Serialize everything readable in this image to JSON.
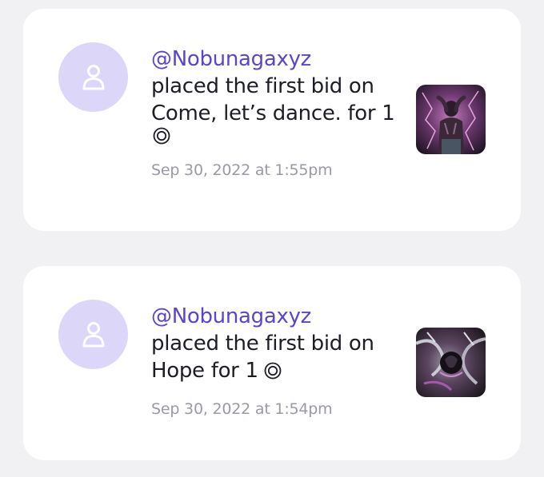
{
  "notifications": [
    {
      "handle": "@Nobunagaxyz",
      "message": "placed the first bid on Come, let’s dance. for 1",
      "currency_icon": "currency-icon",
      "timestamp": "Sep 30, 2022 at 1:55pm",
      "avatar_icon": "user-icon",
      "thumbnail": "nft-thumbnail"
    },
    {
      "handle": "@Nobunagaxyz",
      "message": "placed the first bid on Hope for 1",
      "currency_icon": "currency-icon",
      "timestamp": "Sep 30, 2022 at 1:54pm",
      "avatar_icon": "user-icon",
      "thumbnail": "nft-thumbnail"
    }
  ],
  "colors": {
    "background": "#f1f1f3",
    "card": "#ffffff",
    "handle": "#5a45cf",
    "avatar_bg": "#dcd6f9",
    "timestamp": "#9a9aa6"
  }
}
